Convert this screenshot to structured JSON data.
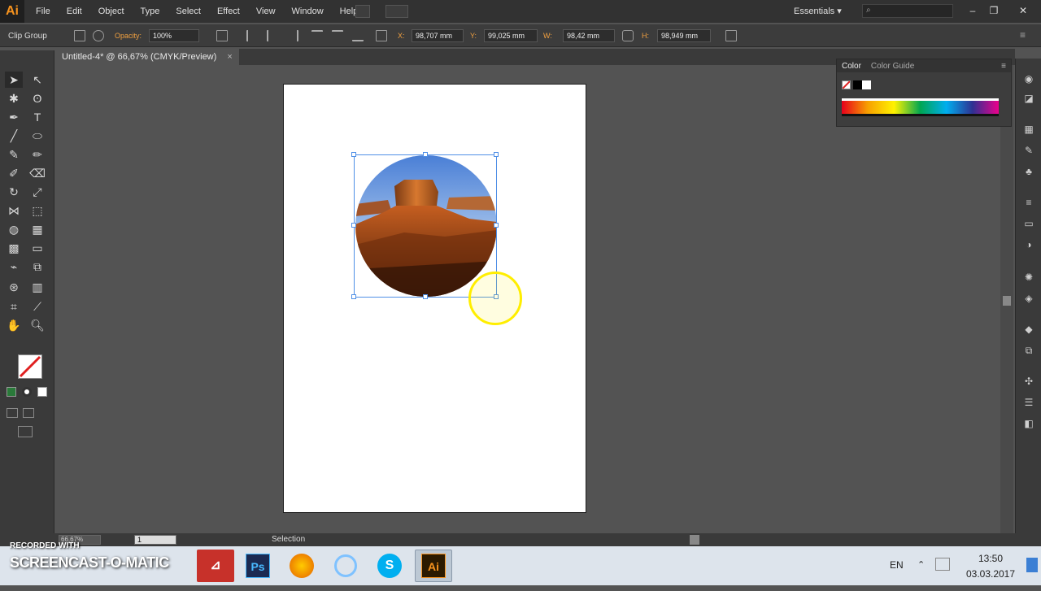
{
  "app": {
    "logo": "Ai"
  },
  "menu": [
    "File",
    "Edit",
    "Object",
    "Type",
    "Select",
    "Effect",
    "View",
    "Window",
    "Help"
  ],
  "workspace": "Essentials",
  "control_bar": {
    "selection_label": "Clip Group",
    "opacity_label": "Opacity:",
    "opacity_value": "100%",
    "x_label": "X:",
    "x_value": "98,707 mm",
    "y_label": "Y:",
    "y_value": "99,025 mm",
    "w_label": "W:",
    "w_value": "98,42 mm",
    "h_label": "H:",
    "h_value": "98,949 mm"
  },
  "document_tab": {
    "title": "Untitled-4* @ 66,67% (CMYK/Preview)",
    "close": "×"
  },
  "color_panel": {
    "tab_color": "Color",
    "tab_guide": "Color Guide"
  },
  "status": {
    "zoom": "66,67%",
    "page": "1",
    "tool": "Selection"
  },
  "taskbar": {
    "watermark_top": "RECORDED WITH",
    "watermark_brand": "SCREENCAST-O-MATIC",
    "apps": [
      {
        "name": "Ps",
        "color": "#1b2a52"
      },
      {
        "name": "Ai",
        "color": "#2b1a00"
      }
    ],
    "language": "EN",
    "time": "13:50",
    "date": "03.03.2017"
  },
  "colors": {
    "accent": "#4f8fe6",
    "ai_orange": "#f7931e",
    "highlight": "#ffee00"
  }
}
